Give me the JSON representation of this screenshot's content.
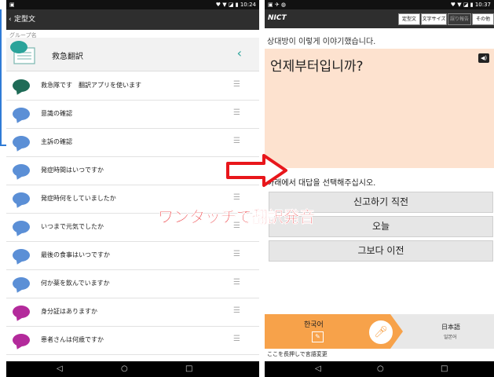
{
  "left": {
    "status": {
      "left": "▣",
      "right": "♥ ▼ ◪ ▮ 10:24"
    },
    "appbar": {
      "back": "‹",
      "title": "定型文"
    },
    "group": {
      "label": "グループ名",
      "name": "救急翻訳",
      "chevron": "‹"
    },
    "items": [
      {
        "text": "救急隊です　翻訳アプリを使います",
        "color": "#1f6b57"
      },
      {
        "text": "意識の確認",
        "color": "#5b8fd6"
      },
      {
        "text": "主訴の確認",
        "color": "#5b8fd6"
      },
      {
        "text": "発症時間はいつですか",
        "color": "#5b8fd6"
      },
      {
        "text": "発症時何をしていましたか",
        "color": "#5b8fd6"
      },
      {
        "text": "いつまで元気でしたか",
        "color": "#5b8fd6"
      },
      {
        "text": "最後の食事はいつですか",
        "color": "#5b8fd6"
      },
      {
        "text": "何か薬を飲んでいますか",
        "color": "#5b8fd6"
      },
      {
        "text": "身分証はありますか",
        "color": "#b32a9b"
      },
      {
        "text": "患者さんは何歳ですか",
        "color": "#b32a9b"
      }
    ],
    "handle_glyph": "☰",
    "nav": {
      "back": "◁",
      "home": "○",
      "recent": "□"
    }
  },
  "right": {
    "status": {
      "left": "▣ ✈ ◍",
      "right": "♥ ▼ ◪ ▮ 10:37"
    },
    "logo": "NICT",
    "toolbar": {
      "fixed": "定型文",
      "font_size": "文字サイズ",
      "report": "誤り報告",
      "other": "その他"
    },
    "prompt": "상대방이 이렇게 이야기했습니다.",
    "phrase": "언제부터입니까?",
    "speaker_icon": "◀)",
    "choose": "아래에서 대답을 선택해주십시오.",
    "options": [
      "신고하기 직전",
      "오늘",
      "그보다 이전"
    ],
    "lang_left": "한국어",
    "lang_right": "日本語",
    "lang_right_sub": "일본어",
    "hint": "ここを長押しで言語変更",
    "nav": {
      "back": "◁",
      "home": "○",
      "recent": "□"
    }
  },
  "annotation": {
    "caption": "ワンタッチで翻訳発音",
    "color": "#e8161b"
  }
}
